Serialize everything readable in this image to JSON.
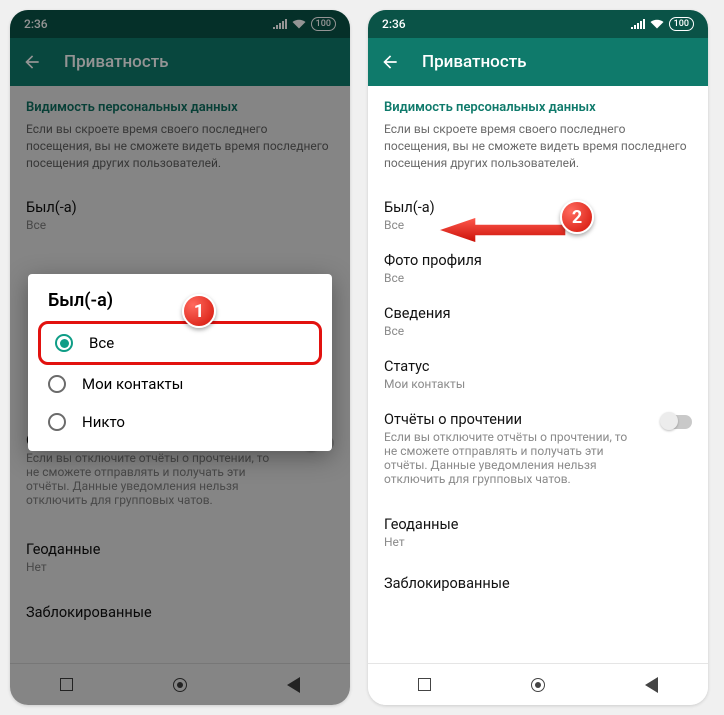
{
  "status": {
    "time": "2:36",
    "battery": "100"
  },
  "appbar": {
    "title": "Приватность"
  },
  "section": {
    "heading": "Видимость персональных данных",
    "desc": "Если вы скроете время своего последнего посещения, вы не сможете видеть время последнего посещения других пользователей."
  },
  "settings": {
    "last_seen": {
      "title": "Был(-а)",
      "value": "Все"
    },
    "profile_photo": {
      "title": "Фото профиля",
      "value": "Все"
    },
    "about": {
      "title": "Сведения",
      "value": "Все"
    },
    "status": {
      "title": "Статус",
      "value": "Мои контакты"
    },
    "read_receipts": {
      "title": "Отчёты о прочтении",
      "desc": "Если вы отключите отчёты о прочтении, то не сможете отправлять и получать эти отчёты. Данные уведомления нельзя отключить для групповых чатов."
    },
    "location": {
      "title": "Геоданные",
      "value": "Нет"
    },
    "blocked": {
      "title": "Заблокированные"
    }
  },
  "dialog": {
    "title": "Был(-а)",
    "opt_all": "Все",
    "opt_contacts": "Мои контакты",
    "opt_nobody": "Никто"
  },
  "steps": {
    "one": "1",
    "two": "2"
  }
}
